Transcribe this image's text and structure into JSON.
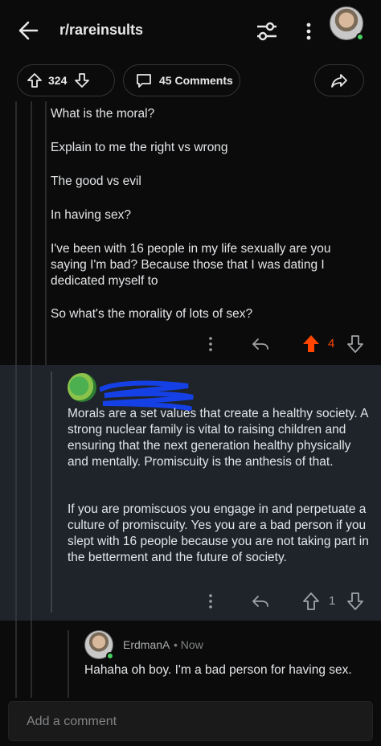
{
  "header": {
    "subreddit": "r/rareinsults"
  },
  "post_actions": {
    "vote_count": "324",
    "comments_label": "45 Comments"
  },
  "comment1": {
    "paragraphs": [
      "What is the moral?",
      "Explain to me the right vs wrong",
      "The good vs evil",
      "In having sex?",
      "I've been with 16 people in my life sexually are you saying I'm bad? Because those that I was dating I dedicated myself to",
      "So what's the morality of lots of sex?"
    ],
    "score": "4",
    "upvoted": true,
    "accent_color": "#ff4500"
  },
  "comment2": {
    "paragraphs": [
      "Morals are a set values that create a healthy society. A strong nuclear family is vital to raising children and ensuring that the next generation healthy physically and mentally. Promiscuity is the anthesis of that.",
      "If you are promiscuos you engage in and perpetuate a culture of promiscuity. Yes you are a bad person if you slept with 16 people because you are not taking part in the betterment and the future of society."
    ],
    "score": "1",
    "highlight_bg": "#1e2429"
  },
  "comment3": {
    "username": "ErdmanA",
    "time": "• Now",
    "text": "Hahaha oh boy.  I'm a bad person for having sex."
  },
  "composer": {
    "placeholder": "Add a comment"
  },
  "icons": [
    "back-arrow-icon",
    "filter-icon",
    "more-vertical-icon",
    "upvote-icon",
    "downvote-icon",
    "comment-bubble-icon",
    "share-icon",
    "reply-icon"
  ]
}
